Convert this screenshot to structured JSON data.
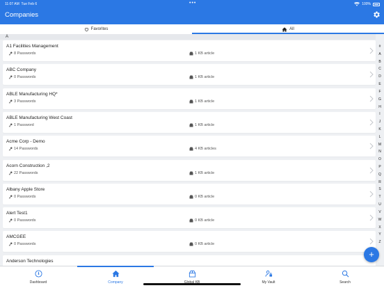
{
  "status": {
    "time": "11:07 AM",
    "date": "Tue Feb 6",
    "dots": "•••",
    "battery": "100%"
  },
  "header": {
    "title": "Companies"
  },
  "segments": {
    "favorites_label": "Favorites",
    "all_label": "All"
  },
  "section": {
    "letter": "A"
  },
  "companies": [
    {
      "name": "A1 Facilities Management",
      "passwords": "8 Passwords",
      "kb": "1 KB article"
    },
    {
      "name": "ABC Company",
      "passwords": "0 Passwords",
      "kb": "1 KB article"
    },
    {
      "name": "ABLE Manufacturing HQ*",
      "passwords": "3 Passwords",
      "kb": "1 KB article"
    },
    {
      "name": "ABLE Manufacturing West Coast",
      "passwords": "1 Password",
      "kb": "1 KB article"
    },
    {
      "name": "Acme Corp - Demo",
      "passwords": "14 Passwords",
      "kb": "4 KB articles"
    },
    {
      "name": "Acorn Construction ,2",
      "passwords": "22 Passwords",
      "kb": "1 KB article"
    },
    {
      "name": "Albany Apple Store",
      "passwords": "0 Passwords",
      "kb": "0 KB article"
    },
    {
      "name": "Alert Test1",
      "passwords": "0 Passwords",
      "kb": "0 KB article"
    },
    {
      "name": "AMCGEE",
      "passwords": "0 Passwords",
      "kb": "0 KB article"
    },
    {
      "name": "Anderson Technologies",
      "passwords": "",
      "kb": ""
    }
  ],
  "alpha_index": [
    "#",
    "A",
    "B",
    "C",
    "D",
    "E",
    "F",
    "G",
    "H",
    "I",
    "J",
    "K",
    "L",
    "M",
    "N",
    "O",
    "P",
    "Q",
    "R",
    "S",
    "T",
    "U",
    "V",
    "W",
    "X",
    "Y",
    "Z"
  ],
  "fab": {
    "label": "+"
  },
  "tabs": {
    "dashboard": "Dashboard",
    "company": "Company",
    "global_kb": "Global KB",
    "my_vault": "My Vault",
    "search": "Search"
  },
  "colors": {
    "accent": "#2b78e4",
    "background": "#eef0f3"
  }
}
